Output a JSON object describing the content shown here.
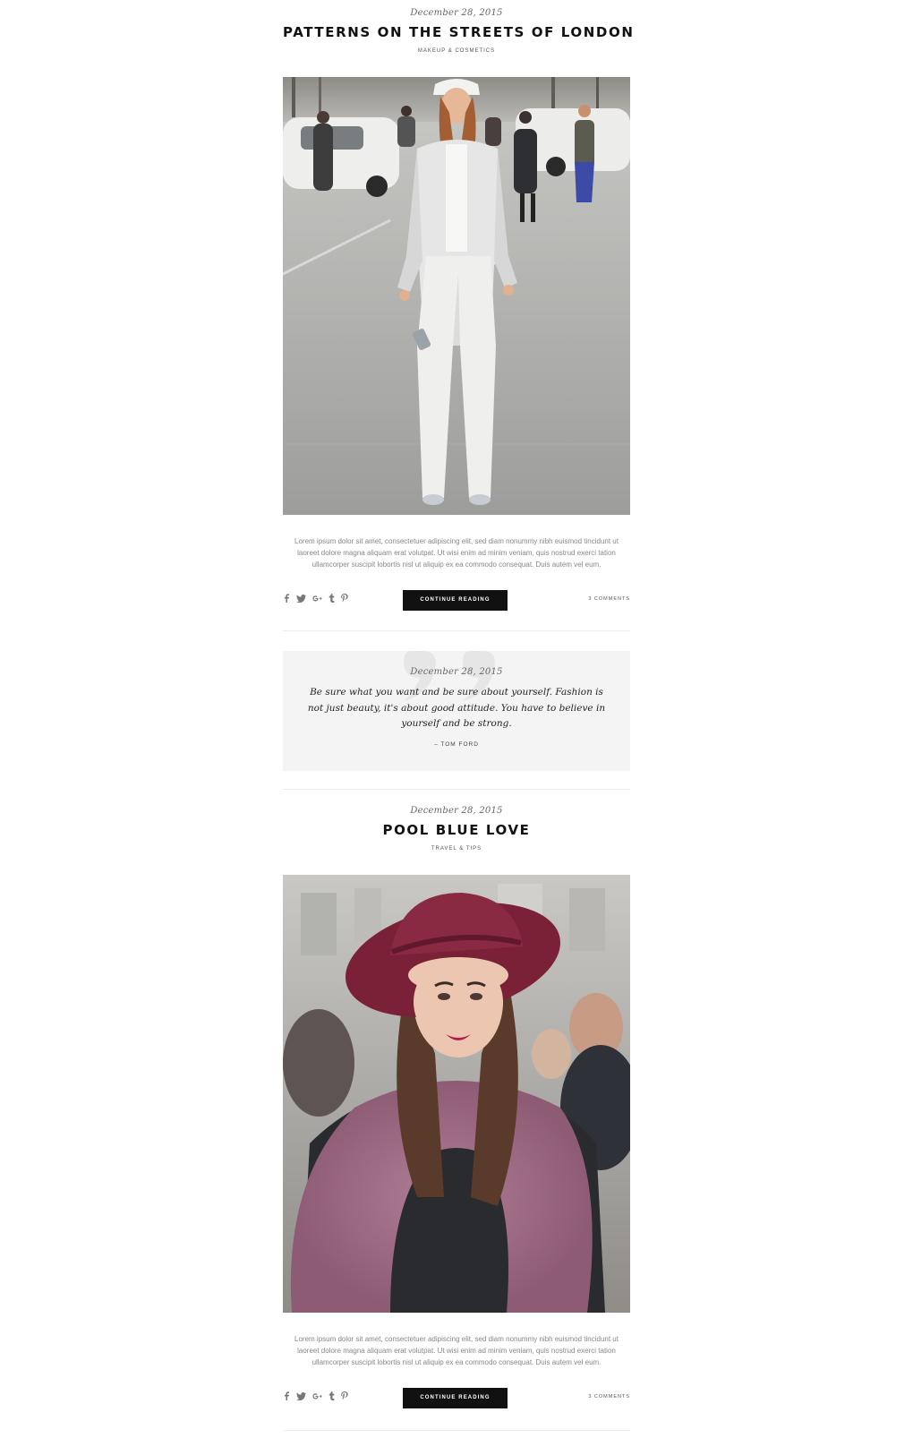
{
  "posts": [
    {
      "date": "December 28, 2015",
      "title": "PATTERNS ON THE STREETS OF LONDON",
      "category": "MAKEUP & COSMETICS",
      "excerpt": "Lorem ipsum dolor sit amet, consectetuer adipiscing elit, sed diam nonummy nibh euismod tincidunt ut laoreet dolore magna aliquam erat volutpat. Ut wisi enim ad minim veniam, quis nostrud exerci tation ullamcorper suscipit lobortis nisl ut aliquip ex ea commodo consequat. Duis autem vel eum.",
      "button_label": "CONTINUE READING",
      "comments": "3 COMMENTS",
      "image_icon": "street-fashion-white-outfit-photo"
    },
    {
      "date": "December 28, 2015",
      "title": "POOL BLUE LOVE",
      "category": "TRAVEL & TIPS",
      "excerpt": "Lorem ipsum dolor sit amet, consectetuer adipiscing elit, sed diam nonummy nibh euismod tincidunt ut laoreet dolore magna aliquam erat volutpat. Ut wisi enim ad minim veniam, quis nostrud exerci tation ullamcorper suscipit lobortis nisl ut aliquip ex ea commodo consequat. Duis autem vel eum.",
      "button_label": "CONTINUE READING",
      "comments": "3 COMMENTS",
      "image_icon": "woman-burgundy-hat-fur-photo"
    }
  ],
  "quote": {
    "date": "December 28, 2015",
    "text": "Be sure what you want and be sure about yourself. Fashion is not just beauty, it's about good attitude. You have to believe in yourself and be strong.",
    "author": "– TOM FORD"
  },
  "share_icons": [
    "facebook-icon",
    "twitter-icon",
    "google-plus-icon",
    "tumblr-icon",
    "pinterest-icon"
  ],
  "colors": {
    "button_bg": "#111111",
    "quote_bg": "#f4f4f4",
    "divider": "#ececec"
  }
}
